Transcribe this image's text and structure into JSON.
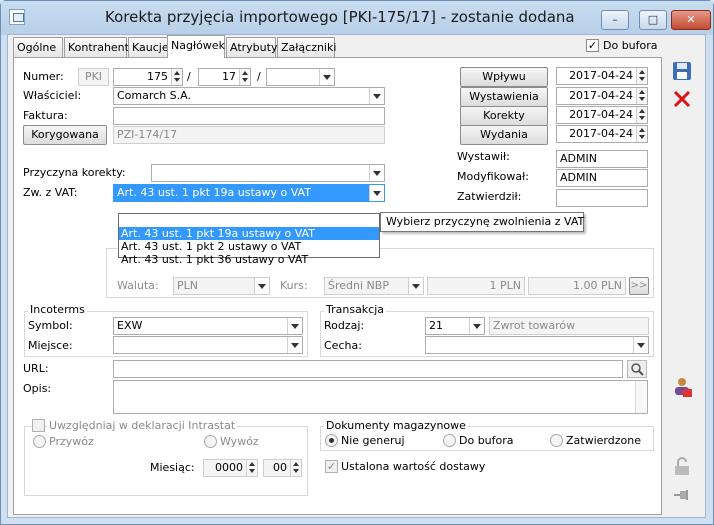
{
  "window": {
    "title": "Korekta przyjęcia importowego [PKI-175/17]  - zostanie dodana",
    "minimize": "–",
    "maximize": "□",
    "close": "✕"
  },
  "tabs": [
    "Ogólne",
    "Kontrahent",
    "Kaucje",
    "Nagłówek",
    "Atrybuty",
    "Załączniki"
  ],
  "do_bufora": {
    "label": "Do bufora",
    "checked": "✓"
  },
  "numer": {
    "label": "Numer:",
    "prefix": "PKI",
    "num": "175",
    "month": "17",
    "sep": "/",
    "series": ""
  },
  "wlasciciel": {
    "label": "Właściciel:",
    "value": "Comarch S.A."
  },
  "faktura": {
    "label": "Faktura:",
    "value": ""
  },
  "korygowana": {
    "button": "Korygowana",
    "value": "PZI-174/17"
  },
  "dates": [
    {
      "button": "Wpływu",
      "value": "2017-04-24"
    },
    {
      "button": "Wystawienia",
      "value": "2017-04-24"
    },
    {
      "button": "Korekty",
      "value": "2017-04-24"
    },
    {
      "button": "Wydania",
      "value": "2017-04-24"
    }
  ],
  "wystawil": {
    "label": "Wystawił:",
    "value": "ADMIN"
  },
  "modyfikowal": {
    "label": "Modyfikował:",
    "value": "ADMIN"
  },
  "zatwierdzil": {
    "label": "Zatwierdził:",
    "value": ""
  },
  "przyczyna": {
    "label": "Przyczyna korekty:",
    "value": ""
  },
  "zwvat": {
    "label": "Zw. z VAT:",
    "value": "Art. 43 ust. 1 pkt 19a ustawy o VAT",
    "options": [
      "",
      "Art. 43 ust. 1 pkt 19a ustawy o VAT",
      "Art. 43 ust. 1 pkt 2 ustawy o VAT",
      "Art. 43 ust. 1 pkt 36 ustawy o VAT"
    ],
    "tooltip": "Wybierz przyczynę zwolnienia z VAT"
  },
  "waluta": {
    "label": "Waluta:",
    "value": "PLN",
    "kurs_label": "Kurs:",
    "kurs_type": "Średni NBP",
    "rate1": "1 PLN",
    "rate2": "1.00 PLN",
    "more": ">>"
  },
  "incoterms": {
    "title": "Incoterms",
    "symbol_label": "Symbol:",
    "symbol": "EXW",
    "miejsce_label": "Miejsce:",
    "miejsce": ""
  },
  "transakcja": {
    "title": "Transakcja",
    "rodzaj_label": "Rodzaj:",
    "rodzaj": "21",
    "rodzaj_desc": "Zwrot towarów",
    "cecha_label": "Cecha:",
    "cecha": ""
  },
  "url": {
    "label": "URL:",
    "value": ""
  },
  "opis": {
    "label": "Opis:",
    "value": ""
  },
  "intrastat": {
    "label": "Uwzględniaj w deklaracji Intrastat",
    "przywoz": "Przywóz",
    "wywoz": "Wywóz",
    "miesiac_label": "Miesiąc:",
    "year": "0000",
    "month": "00"
  },
  "magazyn": {
    "title": "Dokumenty magazynowe",
    "opt1": "Nie generuj",
    "opt2": "Do bufora",
    "opt3": "Zatwierdzone",
    "ustalona": "Ustalona wartość dostawy"
  },
  "colors": {
    "title_bg": "#c4d8ee",
    "selection": "#3399ff",
    "close": "#c94a34"
  }
}
